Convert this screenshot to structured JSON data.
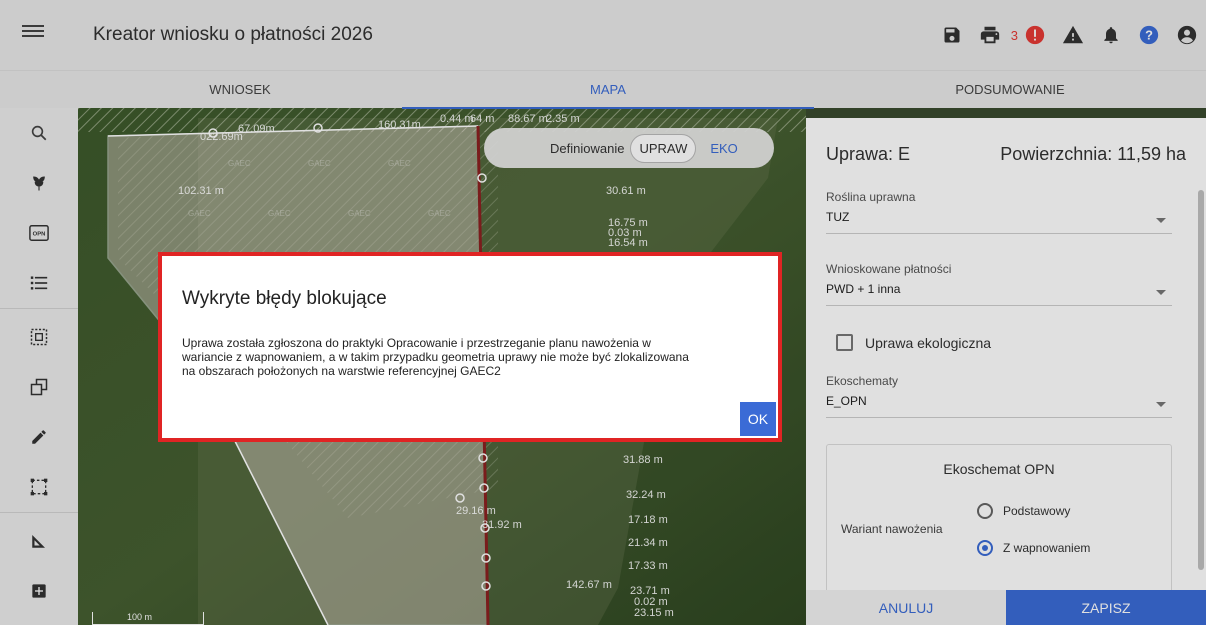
{
  "app": {
    "title": "Kreator wniosku o płatności 2026"
  },
  "header": {
    "error_count": "3"
  },
  "tabs": [
    {
      "label": "WNIOSEK"
    },
    {
      "label": "MAPA"
    },
    {
      "label": "PODSUMOWANIE"
    }
  ],
  "map": {
    "toggle": {
      "label": "Definiowanie",
      "option_selected": "UPRAW",
      "option_other": "EKO"
    },
    "measurements": [
      "022.69m",
      "67.09m",
      "160.31m",
      "0.44 m",
      "64 m",
      "88.67 m",
      "2.35 m",
      "102.31 m",
      "30.61 m",
      "16.75 m",
      "0.03 m",
      "16.54 m",
      "31.88 m",
      "32.24 m",
      "29.16 m",
      "31.92 m",
      "17.18 m",
      "21.34 m",
      "17.33 m",
      "142.67 m",
      "23.71 m",
      "0.02 m",
      "23.15 m"
    ],
    "gaec_label": "GAEC",
    "scale_label": "100 m"
  },
  "panel": {
    "uprawa": "Uprawa: E",
    "powierzchnia": "Powierzchnia: 11,59 ha",
    "roslina_label": "Roślina uprawna",
    "roslina_value": "TUZ",
    "platnosci_label": "Wnioskowane płatności",
    "platnosci_value": "PWD + 1 inna",
    "ekologiczna_label": "Uprawa ekologiczna",
    "ekoschematy_label": "Ekoschematy",
    "ekoschematy_value": "E_OPN",
    "opn_title": "Ekoschemat OPN",
    "wariant_label": "Wariant nawożenia",
    "radio_podstawowy": "Podstawowy",
    "radio_wapnowanie": "Z wapnowaniem",
    "cancel": "ANULUJ",
    "save": "ZAPISZ"
  },
  "dialog": {
    "title": "Wykryte błędy blokujące",
    "line1": "Uprawa została zgłoszona do praktyki Opracowanie i przestrzeganie planu nawożenia w",
    "line2": "wariancie z wapnowaniem, a w takim przypadku geometria uprawy nie może być zlokalizowana",
    "line3": "na obszarach położonych na warstwie referencyjnej GAEC2",
    "ok": "OK"
  },
  "colors": {
    "accent": "#3b6bd6",
    "error": "#e53935",
    "dialog_border": "#e02424"
  },
  "icons": {
    "header": [
      "save-icon",
      "print-icon",
      "error-alert-icon",
      "warning-icon",
      "bell-icon",
      "help-icon",
      "account-icon"
    ],
    "sidebar": [
      "search-icon",
      "plant-icon",
      "opn-icon",
      "list-icon",
      "select-area-icon",
      "copy-shape-icon",
      "edit-pencil-icon",
      "bounding-box-icon",
      "measure-icon",
      "add-icon"
    ]
  }
}
